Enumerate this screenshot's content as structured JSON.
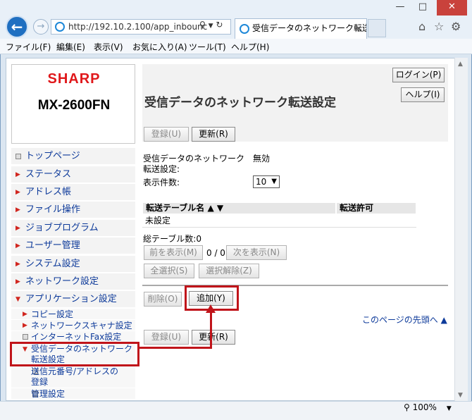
{
  "browser": {
    "url": "http://192.10.2.100/app_inbounc",
    "tab_title": "受信データのネットワーク転送...",
    "tab_close": "×",
    "menu": [
      "ファイル(F)",
      "編集(E)",
      "表示(V)",
      "お気に入り(A)",
      "ツール(T)",
      "ヘルプ(H)"
    ],
    "zoom": "100%"
  },
  "header": {
    "brand": "SHARP",
    "model": "MX-2600FN",
    "login_label": "ログイン(P)",
    "help_label": "ヘルプ(I)",
    "page_title": "受信データのネットワーク転送設定"
  },
  "sidebar": {
    "items": [
      {
        "label": "トップページ"
      },
      {
        "label": "ステータス"
      },
      {
        "label": "アドレス帳"
      },
      {
        "label": "ファイル操作"
      },
      {
        "label": "ジョブプログラム"
      },
      {
        "label": "ユーザー管理"
      },
      {
        "label": "システム設定"
      },
      {
        "label": "ネットワーク設定"
      },
      {
        "label": "アプリケーション設定"
      },
      {
        "label": "コピー設定"
      },
      {
        "label": "ネットワークスキャナ設定"
      },
      {
        "label": "インターネットFax設定"
      },
      {
        "label": "受信データのネットワーク",
        "label2": "転送設定"
      },
      {
        "label": "送信元番号/アドレスの",
        "label2": "登録"
      },
      {
        "label": "管理設定"
      }
    ]
  },
  "toolbar": {
    "register_label": "登録(U)",
    "refresh_label": "更新(R)"
  },
  "settings": {
    "forward_label_line1": "受信データのネットワーク",
    "forward_label_line2": "転送設定:",
    "forward_value": "無効",
    "count_label": "表示件数:",
    "count_value": "10"
  },
  "table": {
    "col1": "転送テーブル名 ▲ ▼",
    "col2": "転送許可",
    "row1": "未設定",
    "total": "総テーブル数:0"
  },
  "pager": {
    "prev_label": "前を表示(M)",
    "page_info": "0 / 0",
    "next_label": "次を表示(N)",
    "select_all": "全選択(S)",
    "deselect": "選択解除(Z)"
  },
  "actions": {
    "delete_label": "削除(O)",
    "add_label": "追加(Y)",
    "top_link": "このページの先頭へ ▲"
  },
  "colors": {
    "brand_red": "#e0181b",
    "link_blue": "#0d3a9a",
    "highlight_red": "#c0141a"
  }
}
